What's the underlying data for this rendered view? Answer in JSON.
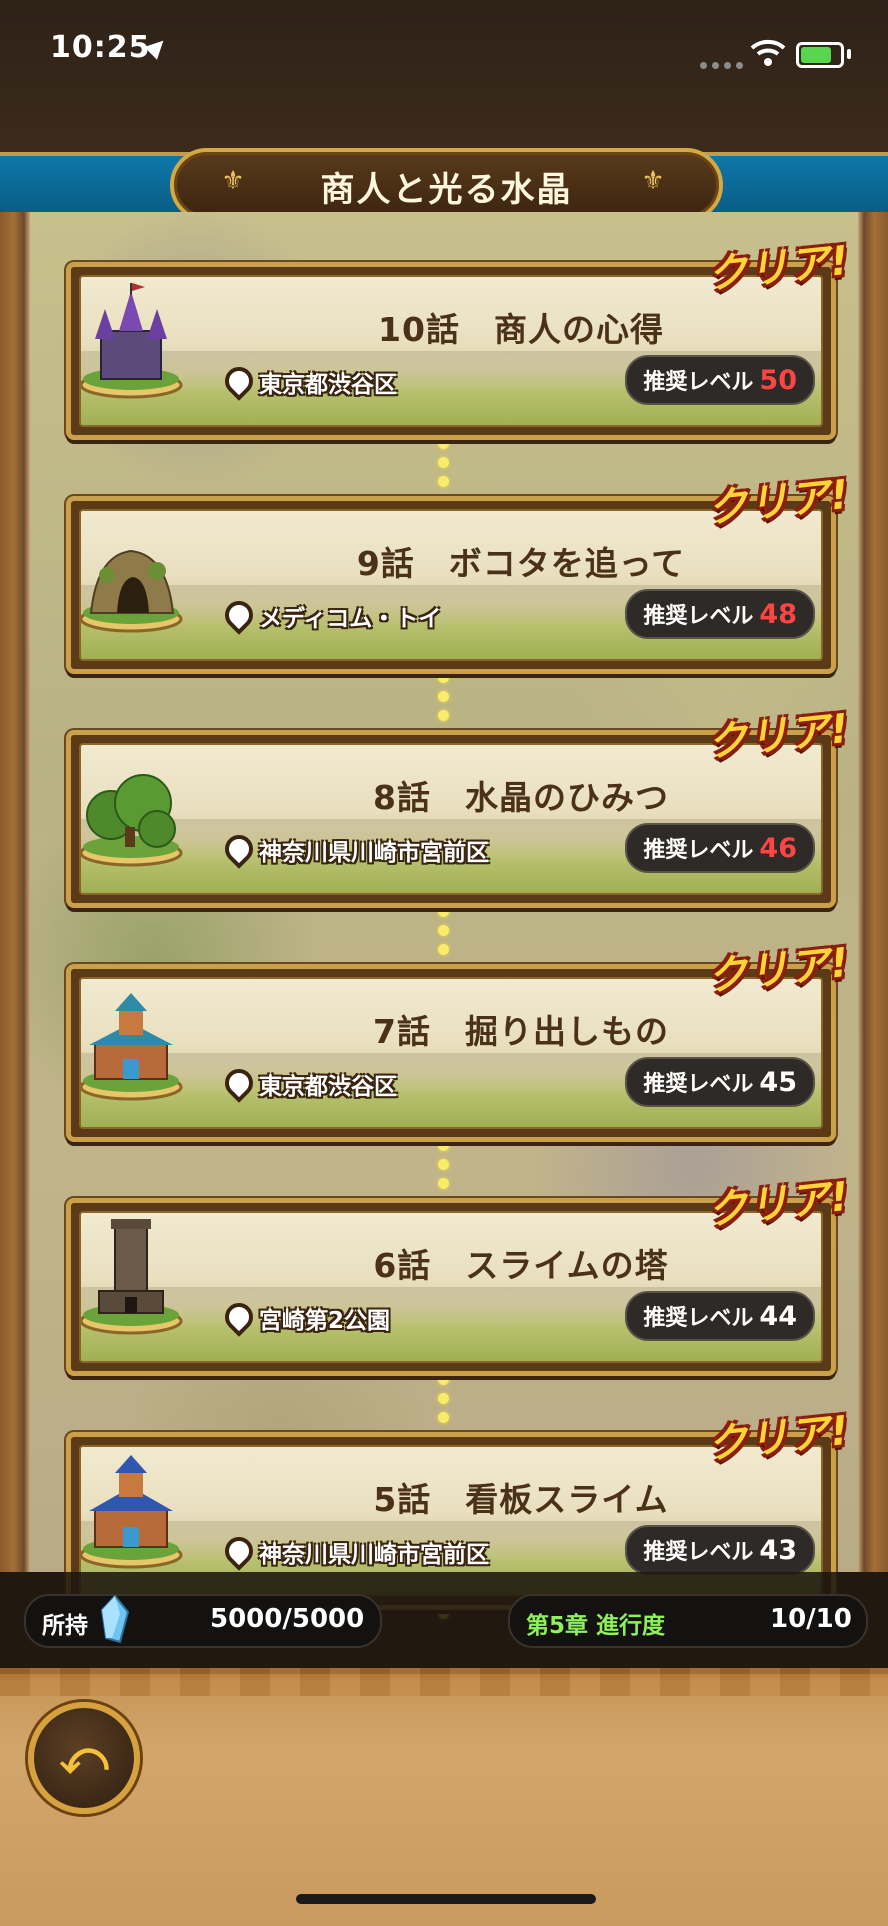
{
  "status": {
    "time": "10:25"
  },
  "header": {
    "title": "商人と光る水晶"
  },
  "episodes": [
    {
      "title": "10話　商人の心得",
      "location": "東京都渋谷区",
      "level_label": "推奨レベル",
      "level": "50",
      "level_color": "red",
      "badge": "クリア!",
      "building": "castle-icon"
    },
    {
      "title": "9話　ボコタを追って",
      "location": "メディコム・トイ",
      "level_label": "推奨レベル",
      "level": "48",
      "level_color": "red",
      "badge": "クリア!",
      "building": "cave-icon"
    },
    {
      "title": "8話　水晶のひみつ",
      "location": "神奈川県川崎市宮前区",
      "level_label": "推奨レベル",
      "level": "46",
      "level_color": "red",
      "badge": "クリア!",
      "building": "forest-icon"
    },
    {
      "title": "7話　掘り出しもの",
      "location": "東京都渋谷区",
      "level_label": "推奨レベル",
      "level": "45",
      "level_color": "white",
      "badge": "クリア!",
      "building": "mansion-icon"
    },
    {
      "title": "6話　スライムの塔",
      "location": "宮崎第2公園",
      "level_label": "推奨レベル",
      "level": "44",
      "level_color": "white",
      "badge": "クリア!",
      "building": "tower-icon"
    },
    {
      "title": "5話　看板スライム",
      "location": "神奈川県川崎市宮前区",
      "level_label": "推奨レベル",
      "level": "43",
      "level_color": "white",
      "badge": "クリア!",
      "building": "shop-icon"
    }
  ],
  "info_bar": {
    "owned_label": "所持",
    "owned_value": "5000/5000",
    "progress_label": "第5章 進行度",
    "progress_value": "10/10"
  }
}
